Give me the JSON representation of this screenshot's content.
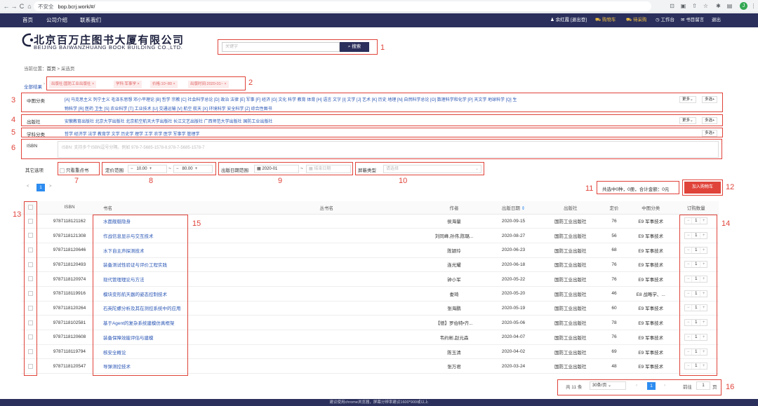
{
  "browser": {
    "back": "←",
    "forward": "→",
    "reload": "C",
    "home": "⌂",
    "insecure_label": "不安全",
    "url": "bop.bcrj.work/#/",
    "profile_initial": "J"
  },
  "topnav": {
    "menu": [
      "首页",
      "公司介绍",
      "联系我们"
    ],
    "user": "余红霞 [退出登]",
    "cart": "购物车",
    "purchase": "待采购",
    "workbench": "工作台",
    "message": "书目留言",
    "logout": "退出"
  },
  "logo": {
    "cn": "北京百万庄图书大厦有限公司",
    "en": "BEIJING BAIWANZHUANG BOOK BUILDING CO.,LTD."
  },
  "search": {
    "placeholder": "关键字",
    "button": "搜索"
  },
  "breadcrumb": {
    "prefix": "当前位置：",
    "home": "首页",
    "sep": " > ",
    "current": "采选页"
  },
  "filter_tags": {
    "all_label": "全部结果",
    "tags": [
      "出版社:国防工业出版社",
      "学科:军事学",
      "价格:10~80",
      "出版时间:2020-01~"
    ]
  },
  "filters": {
    "category": {
      "label": "中图分类",
      "line1": "[A] 马克思主义 列宁主义 毛泽东思想 邓小平理论   [B] 哲学 宗教   [C] 社会科学总论   [D] 政治 法律   [E] 军事   [F] 经济   [G] 文化 科学 教育 体育   [H] 语言 文字   [I] 文学   [J] 艺术   [K] 历史 地理   [N] 自然科学总论   [O] 数理科学和化学   [P] 天文学 地球科学   [Q] 生",
      "line2": "物科学   [R] 医药 卫生   [S] 农业科学   [T] 工业技术   [U] 交通运输   [V] 航空 航天   [X] 环境科学 安全科学   [Z] 综合性图书"
    },
    "publisher": {
      "label": "出版社",
      "items": "安徽教育出版社    北京大学出版社    北京航空航天大学出版社    长江文艺出版社    广西师范大学出版社    国防工业出版社"
    },
    "subject": {
      "label": "学科分类",
      "items": "哲学    经济学    法学    教育学    文学    历史学    理学    工学    农学    医学    军事学    管理学"
    },
    "more_label": "更多",
    "multi_label": "多选",
    "isbn": {
      "label": "ISBN",
      "placeholder": "ISBN: 支持多个ISBN逗号分隔。例如 978-7-5685-1578-8,978-7-5685-1578-7"
    }
  },
  "options": {
    "label": "其它选项",
    "only_stock": "只看重点书",
    "price_label": "定价范围",
    "price_min": "10.00",
    "price_max": "80.00",
    "date_label": "出版日期范围",
    "date_start": "2020-01",
    "date_end_placeholder": "结束日期",
    "binding_label": "屏蔽类型",
    "binding_placeholder": "请选择"
  },
  "top_pager": {
    "current": "1",
    "prev": "<",
    "next": ">"
  },
  "summary": {
    "text": "共选中0种，0册，合计金额：0元",
    "add_cart": "加入购物车"
  },
  "table": {
    "headers": [
      "ISBN",
      "书名",
      "丛书名",
      "作者",
      "出版日期",
      "出版社",
      "定价",
      "中图分类",
      "订购数量"
    ],
    "rows": [
      {
        "isbn": "9787118121162",
        "title": "水面舰艇隐身",
        "series": "",
        "author": "侯海量",
        "date": "2020-09-15",
        "publisher": "国防工业出版社",
        "price": "76",
        "category": "E9 军事技术",
        "qty": "1"
      },
      {
        "isbn": "9787118121308",
        "title": "作战信息显示与交互技术",
        "series": "",
        "author": "刘同峰,孙伟,陈璐...",
        "date": "2020-08-27",
        "publisher": "国防工业出版社",
        "price": "56",
        "category": "E9 军事技术",
        "qty": "1"
      },
      {
        "isbn": "9787118120646",
        "title": "水下自主声探测技术",
        "series": "",
        "author": "陈颖玲",
        "date": "2020-06-23",
        "publisher": "国防工业出版社",
        "price": "68",
        "category": "E9 军事技术",
        "qty": "1"
      },
      {
        "isbn": "9787118120493",
        "title": "装备测试性验证与评价工程实践",
        "series": "",
        "author": "连光耀",
        "date": "2020-06-18",
        "publisher": "国防工业出版社",
        "price": "76",
        "category": "E9 军事技术",
        "qty": "1"
      },
      {
        "isbn": "9787118120974",
        "title": "现代管理理论与方法",
        "series": "",
        "author": "钟小军",
        "date": "2020-05-22",
        "publisher": "国防工业出版社",
        "price": "76",
        "category": "E9 军事技术",
        "qty": "1"
      },
      {
        "isbn": "9787118119916",
        "title": "模块变形航天器的姿态控制技术",
        "series": "",
        "author": "娄琦",
        "date": "2020-05-20",
        "publisher": "国防工业出版社",
        "price": "46",
        "category": "E8 战略学、...",
        "qty": "1"
      },
      {
        "isbn": "9787118120264",
        "title": "石英陀螺分析及其在测控系统中的应用",
        "series": "",
        "author": "张海鹏",
        "date": "2020-05-19",
        "publisher": "国防工业出版社",
        "price": "60",
        "category": "E9 军事技术",
        "qty": "1"
      },
      {
        "isbn": "9787118102581",
        "title": "基于Agent的复杂系统建模仿真框架",
        "series": "",
        "author": "【德】罗伯特•齐...",
        "date": "2020-05-06",
        "publisher": "国防工业出版社",
        "price": "78",
        "category": "E9 军事技术",
        "qty": "1"
      },
      {
        "isbn": "9787118120608",
        "title": "装备保障效能评估与建模",
        "series": "",
        "author": "韦约彬,赵元森",
        "date": "2020-04-07",
        "publisher": "国防工业出版社",
        "price": "76",
        "category": "E9 军事技术",
        "qty": "1"
      },
      {
        "isbn": "9787118119794",
        "title": "核安全概论",
        "series": "",
        "author": "陈玉清",
        "date": "2020-04-02",
        "publisher": "国防工业出版社",
        "price": "69",
        "category": "E9 军事技术",
        "qty": "1"
      },
      {
        "isbn": "9787118120547",
        "title": "导弹测控技术",
        "series": "",
        "author": "张万君",
        "date": "2020-03-24",
        "publisher": "国防工业出版社",
        "price": "48",
        "category": "E9 军事技术",
        "qty": "1"
      }
    ]
  },
  "bottom_pager": {
    "total": "共 11 条",
    "page_size": "30条/页",
    "current": "1",
    "goto_label": "前往",
    "goto_value": "1",
    "goto_suffix": "页"
  },
  "footer": {
    "text": "建议使用chrome浏览器，屏幕分辨率建议1600*900或以上"
  },
  "annotations": [
    "1",
    "2",
    "3",
    "4",
    "5",
    "6",
    "7",
    "8",
    "9",
    "10",
    "11",
    "12",
    "13",
    "14",
    "15",
    "16"
  ],
  "colors": {
    "nav": "#2a2f5b",
    "annotation": "#e0433a",
    "link": "#2a56b5",
    "accent": "#2d8cf0"
  }
}
